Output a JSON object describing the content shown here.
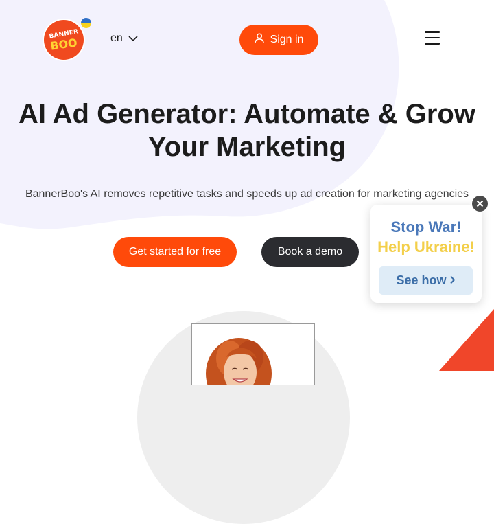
{
  "header": {
    "logo_top": "BANNER",
    "logo_bottom": "BOO",
    "language": "en",
    "signin_label": "Sign in"
  },
  "hero": {
    "title_line1": "AI Ad Generator: Automate & Grow",
    "title_line2": "Your Marketing",
    "subtitle": "BannerBoo's AI removes repetitive tasks and speeds up ad creation for marketing agencies",
    "primary_cta": "Get started for free",
    "secondary_cta": "Book a demo"
  },
  "ukraine_popup": {
    "line1": "Stop War!",
    "line2": "Help Ukraine!",
    "button_label": "See how"
  },
  "colors": {
    "accent": "#ff4a0a",
    "dark_button": "#2b2c30",
    "blob": "#f3f2fd",
    "ukraine_blue": "#4a78b9",
    "ukraine_yellow": "#f3cf4a"
  },
  "icons": {
    "language": "chevron-down-icon",
    "signin": "user-icon",
    "menu": "hamburger-menu-icon",
    "close": "close-icon",
    "see_how": "chevron-right-icon"
  }
}
